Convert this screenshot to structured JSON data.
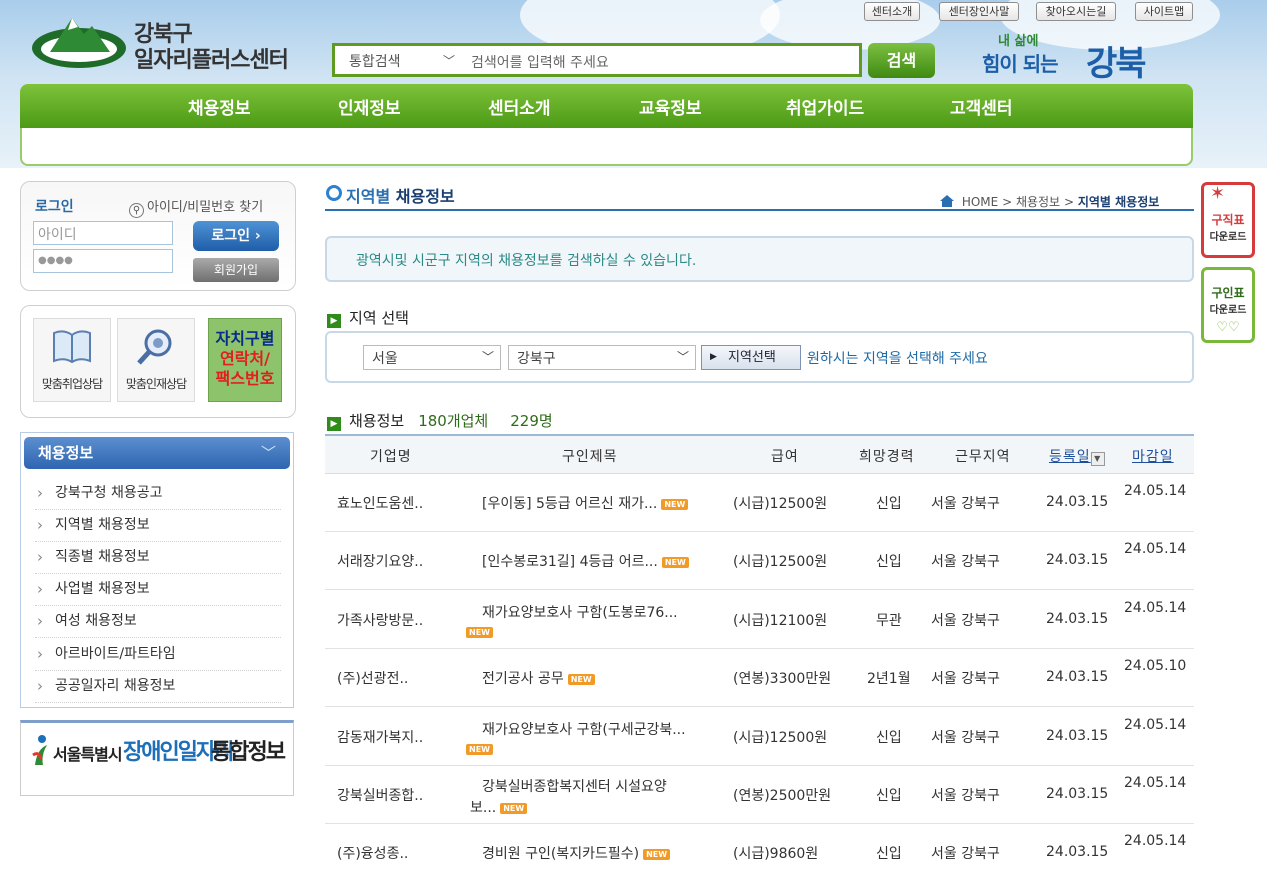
{
  "header": {
    "logo_line1": "강북구",
    "logo_line2": "일자리플러스센터",
    "util_links": [
      "센터소개",
      "센터장인사말",
      "찾아오시는길",
      "사이트맵"
    ],
    "search": {
      "category": "통합검색",
      "placeholder": "검색어를 입력해 주세요",
      "button": "검색"
    },
    "slogan_small": "내 삶에",
    "slogan_mid": "힘이 되는",
    "slogan_big": "강북",
    "nav": [
      "채용정보",
      "인재정보",
      "센터소개",
      "교육정보",
      "취업가이드",
      "고객센터"
    ]
  },
  "login": {
    "title": "로그인",
    "find_link": "아이디/비밀번호 찾기",
    "id_placeholder": "아이디",
    "pw_value": "●●●●",
    "login_button": "로그인",
    "join_button": "회원가입"
  },
  "quick_links": {
    "item1": "맞춤취업상담",
    "item2": "맞춤인재상담",
    "contact_line1": "자치구별",
    "contact_line2": "연락처/",
    "contact_line3": "팩스번호"
  },
  "side_menu": {
    "title": "채용정보",
    "items": [
      "강북구청 채용공고",
      "지역별 채용정보",
      "직종별 채용정보",
      "사업별 채용정보",
      "여성 채용정보",
      "아르바이트/파트타임",
      "공공일자리 채용정보"
    ]
  },
  "banner": {
    "t1": "서울특별시",
    "t2": "장애인일자리",
    "t3": "통합정보"
  },
  "main": {
    "title_a": "지역별",
    "title_b": "채용정보",
    "breadcrumb": {
      "home": "HOME",
      "level1": "채용정보",
      "current": "지역별 채용정보"
    },
    "info": "광역시및 시군구 지역의 채용정보를 검색하실 수 있습니다.",
    "region_section": "지역 선택",
    "region_city": "서울",
    "region_district": "강북구",
    "region_button": "지역선택",
    "region_hint": "원하시는 지역을 선택해 주세요",
    "list_section": "채용정보",
    "company_count": "180개업체",
    "people_count": "229명",
    "badge_new": "NEW",
    "columns": [
      "기업명",
      "구인제목",
      "급여",
      "희망경력",
      "근무지역",
      "등록일",
      "마감일"
    ]
  },
  "rows": [
    {
      "company": "효노인도움센..",
      "title1": "[우이동] 5등급 어르신 재가...",
      "title2": "",
      "pay": "(시급)12500원",
      "career": "신입",
      "area": "서울 강북구",
      "reg": "24.03.15",
      "due": "24.05.14"
    },
    {
      "company": "서래장기요양..",
      "title1": "[인수봉로31길] 4등급 어르...",
      "title2": "",
      "pay": "(시급)12500원",
      "career": "신입",
      "area": "서울 강북구",
      "reg": "24.03.15",
      "due": "24.05.14"
    },
    {
      "company": "가족사랑방문..",
      "title1": "재가요양보호사 구함(도봉로76...",
      "title2": "",
      "pay": "(시급)12100원",
      "career": "무관",
      "area": "서울 강북구",
      "reg": "24.03.15",
      "due": "24.05.14"
    },
    {
      "company": "(주)선광전..",
      "title1": "전기공사 공무",
      "title2": "",
      "pay": "(연봉)3300만원",
      "career": "2년1월",
      "area": "서울 강북구",
      "reg": "24.03.15",
      "due": "24.05.10"
    },
    {
      "company": "감동재가복지..",
      "title1": "재가요양보호사 구함(구세군강북...",
      "title2": "",
      "pay": "(시급)12500원",
      "career": "신입",
      "area": "서울 강북구",
      "reg": "24.03.15",
      "due": "24.05.14"
    },
    {
      "company": "강북실버종합..",
      "title1": "강북실버종합복지센터 시설요양",
      "title2": "보...",
      "pay": "(연봉)2500만원",
      "career": "신입",
      "area": "서울 강북구",
      "reg": "24.03.15",
      "due": "24.05.14"
    },
    {
      "company": "(주)융성종..",
      "title1": "경비원 구인(복지카드필수)",
      "title2": "",
      "pay": "(시급)9860원",
      "career": "신입",
      "area": "서울 강북구",
      "reg": "24.03.15",
      "due": "24.05.14"
    }
  ],
  "side_quick": [
    {
      "label": "구직표",
      "sub": "다운로드"
    },
    {
      "label": "구인표",
      "sub": "다운로드"
    }
  ],
  "colors": {
    "nav_green": "#5ea822",
    "title_blue": "#2b6fb3",
    "new_orange": "#f29a26"
  }
}
